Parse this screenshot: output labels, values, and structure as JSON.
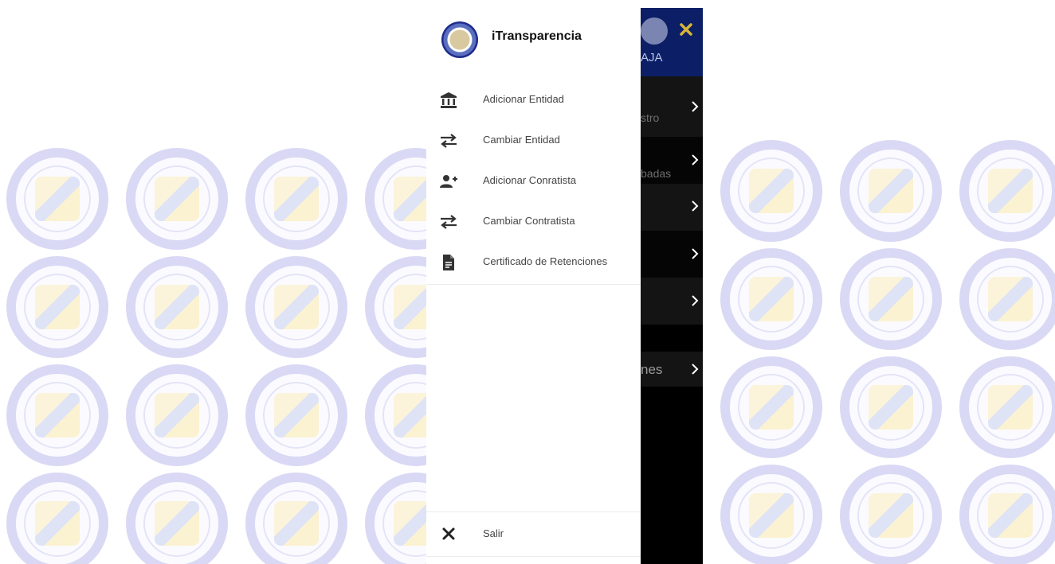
{
  "drawer": {
    "title": "iTransparencia",
    "menu": [
      {
        "label": "Adicionar Entidad",
        "icon": "bank-icon"
      },
      {
        "label": "Cambiar Entidad",
        "icon": "swap-icon"
      },
      {
        "label": "Adicionar Conratista",
        "icon": "person-add-icon"
      },
      {
        "label": "Cambiar Contratista",
        "icon": "swap-icon"
      },
      {
        "label": "Certificado de Retenciones",
        "icon": "document-icon"
      }
    ],
    "logout_label": "Salir",
    "logout_icon": "close-icon"
  },
  "background_app": {
    "header_text": "AJA",
    "rows": [
      "stro",
      "badas",
      "",
      "",
      "",
      "nes"
    ],
    "colors": {
      "header": "#0c1f66",
      "close_icon": "#d4b43a",
      "panel": "#000000"
    }
  },
  "watermark": {
    "lettering": [
      "CALIDAD",
      "SOFTWARE",
      "SERVICIO",
      "PCT LTDA"
    ],
    "color": "#d9d9f5"
  }
}
